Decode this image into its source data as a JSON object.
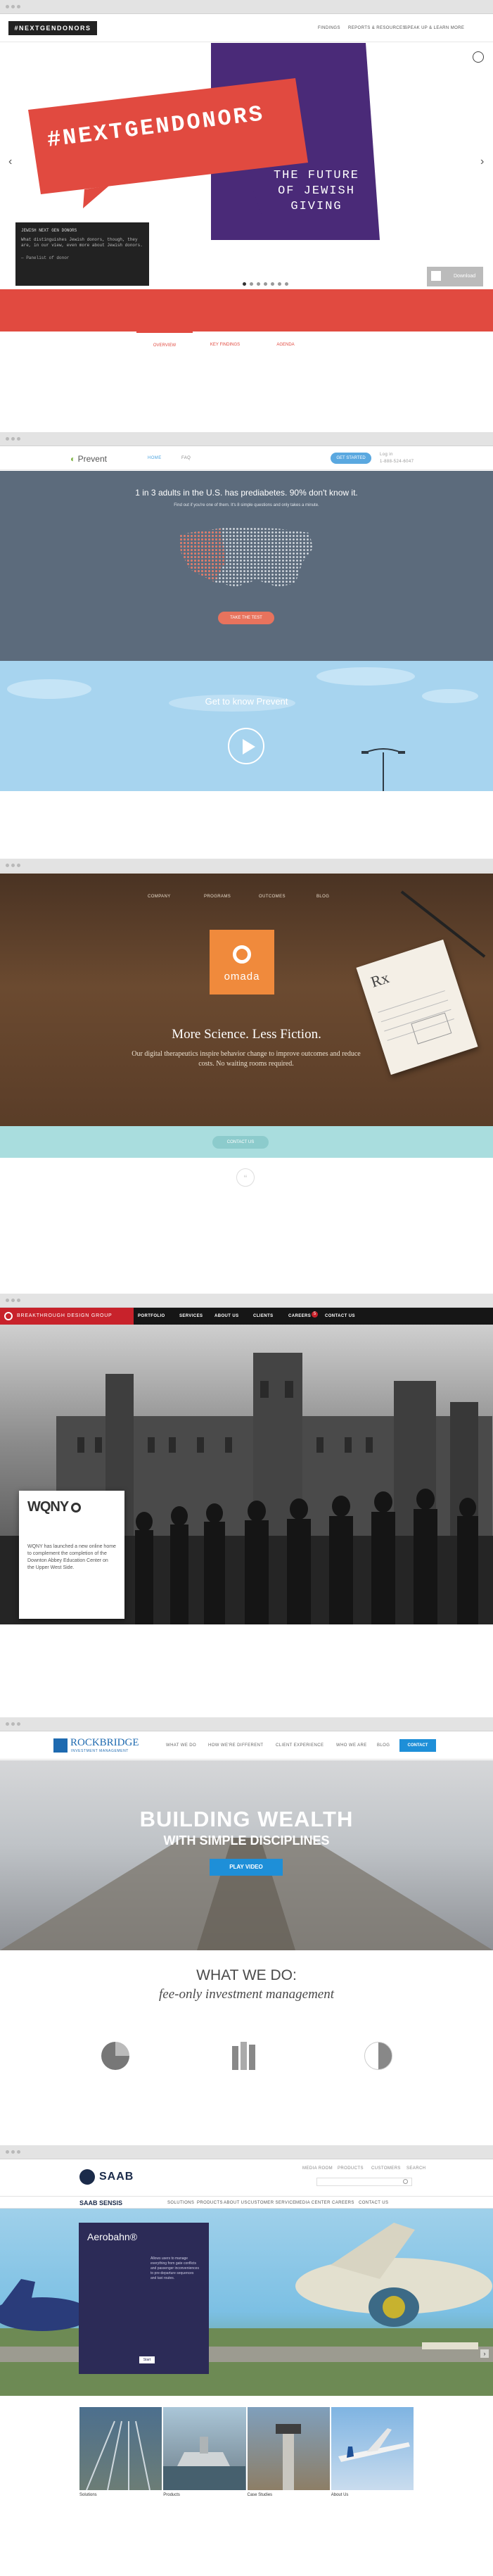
{
  "s1": {
    "logo": "#NEXTGENDONORS",
    "nav": [
      "FINDINGS",
      "REPORTS & RESOURCES",
      "SPEAK UP & LEARN MORE"
    ],
    "banner_title": "#NEXTGENDONORS",
    "banner_subtitle": "THE FUTURE OF JEWISH GIVING",
    "quote_heading": "JEWISH NEXT GEN DONORS",
    "quote_body": "What distinguishes Jewish donors, though, they are, in our view, even more about Jewish donors.",
    "quote_author": "— Panelist of donor",
    "feature_button": "Download",
    "tabs": [
      "OVERVIEW",
      "KEY FINDINGS",
      "AGENDA"
    ],
    "carousel_count": 9,
    "carousel_active": 1
  },
  "s2": {
    "logo": "Prevent",
    "nav": [
      "HOME",
      "FAQ"
    ],
    "cta": "GET STARTED",
    "phone": "1-888-524-6047",
    "login": "Log in",
    "headline": "1 in 3 adults in the U.S. has prediabetes. 90% don't know it.",
    "subtext": "Find out if you're one of them. It's 8 simple questions and only takes a minute.",
    "button": "TAKE THE TEST",
    "video_heading": "Get to know Prevent"
  },
  "s3": {
    "nav": [
      "COMPANY",
      "PROGRAMS",
      "OUTCOMES",
      "BLOG"
    ],
    "logo_text": "omada",
    "headline": "More Science. Less Fiction.",
    "body": "Our digital therapeutics inspire behavior change to improve outcomes and reduce costs. No waiting rooms required.",
    "button": "CONTACT US",
    "rx": "Rx"
  },
  "s4": {
    "logo": "BREAKTHROUGH DESIGN GROUP",
    "nav": [
      "PORTFOLIO",
      "SERVICES",
      "ABOUT US",
      "CLIENTS",
      "CAREERS",
      "CONTACT US"
    ],
    "careers_badge": "5",
    "client_logo": "WQNY",
    "card_text": "WQNY has launched a new online home to complement the completion of the Downton Abbey Education Center on the Upper West Side."
  },
  "s5": {
    "logo_main": "ROCKBRIDGE",
    "logo_sub": "INVESTMENT MANAGEMENT",
    "nav": [
      "WHAT WE DO",
      "HOW WE'RE DIFFERENT",
      "CLIENT EXPERIENCE",
      "WHO WE ARE",
      "BLOG"
    ],
    "contact": "CONTACT",
    "hero_line1": "BUILDING WEALTH",
    "hero_line2": "WITH SIMPLE DISCIPLINES",
    "hero_button": "PLAY VIDEO",
    "section_title": "WHAT WE DO:",
    "section_subtitle": "fee-only investment management"
  },
  "s6": {
    "logo": "SAAB",
    "top_links": [
      "MEDIA ROOM",
      "PRODUCTS",
      "CUSTOMERS",
      "SEARCH"
    ],
    "brand": "SAAB SENSIS",
    "nav": [
      "SOLUTIONS",
      "PRODUCTS",
      "ABOUT US",
      "CUSTOMER SERVICE",
      "MEDIA CENTER",
      "CAREERS",
      "CONTACT US"
    ],
    "card_title": "Aerobahn®",
    "card_text": "Allows users to manage everything from gate conflicts and passenger inconveniences to pre-departure sequences and taxi routes.",
    "card_button": "Start",
    "thumbs": [
      "Solutions",
      "Products",
      "Case Studies",
      "About Us"
    ],
    "accent": "#1f5f9c"
  }
}
